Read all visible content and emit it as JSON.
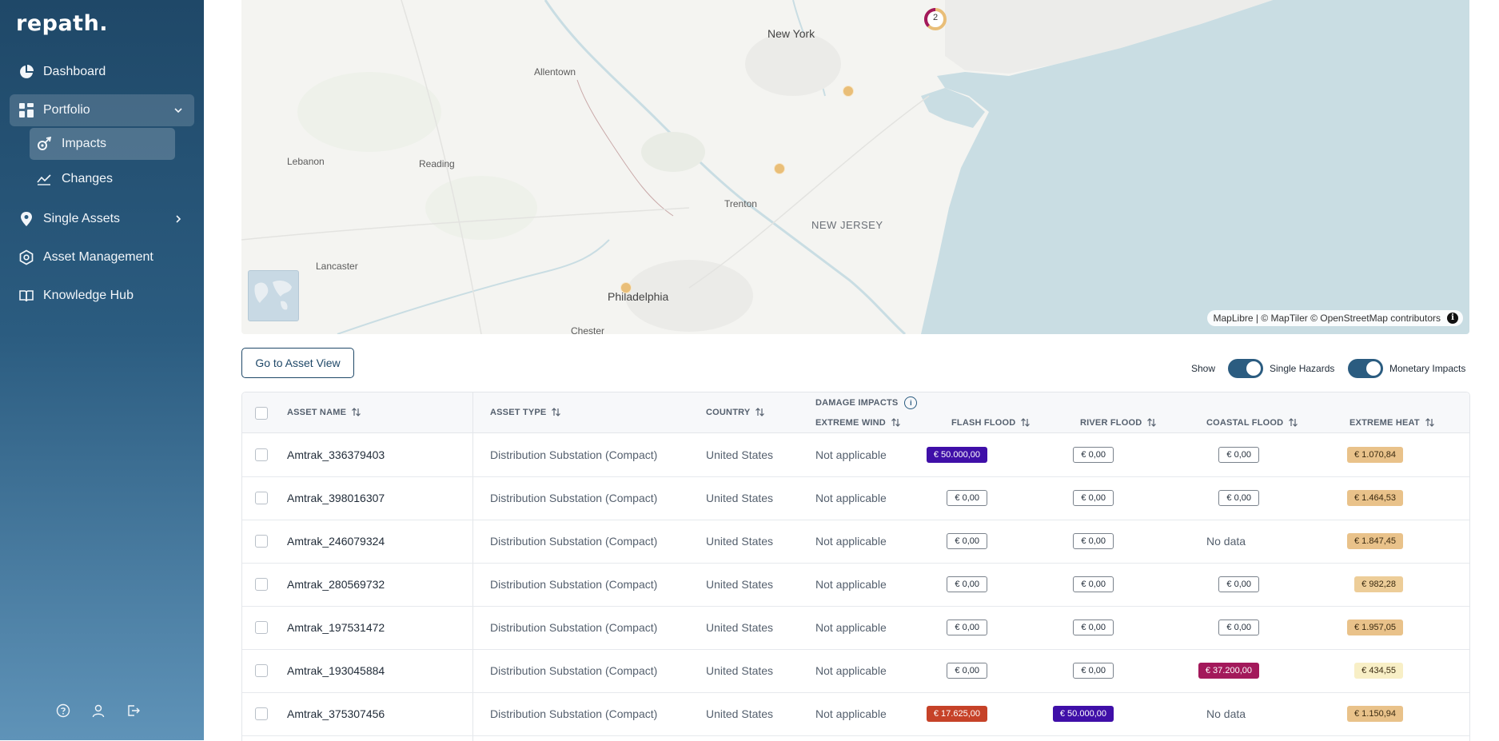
{
  "sidebar": {
    "logo": "repath.",
    "items": [
      {
        "label": "Dashboard"
      },
      {
        "label": "Portfolio"
      },
      {
        "label": "Impacts"
      },
      {
        "label": "Changes"
      },
      {
        "label": "Single Assets"
      },
      {
        "label": "Asset Management"
      },
      {
        "label": "Knowledge Hub"
      }
    ],
    "bottom_icons": [
      "help-icon",
      "user-icon",
      "logout-icon"
    ]
  },
  "map": {
    "labels": {
      "new_york": "New York",
      "allentown": "Allentown",
      "lebanon": "Lebanon",
      "reading": "Reading",
      "trenton": "Trenton",
      "new_jersey": "NEW JERSEY",
      "lancaster": "Lancaster",
      "philadelphia": "Philadelphia",
      "chester": "Chester"
    },
    "cluster_count": "2",
    "attribution": "MapLibre | © MapTiler © OpenStreetMap contributors",
    "colors": {
      "land": "#f4f4f1",
      "water": "#c9dde3",
      "marker": "#e9be78",
      "cluster": "#a3195b"
    }
  },
  "toolbar": {
    "asset_view_button": "Go to Asset View",
    "show_label": "Show",
    "toggle_single_hazards": "Single Hazards",
    "toggle_monetary_impacts": "Monetary Impacts"
  },
  "table": {
    "headers": {
      "asset_name": "ASSET NAME",
      "asset_type": "ASSET TYPE",
      "country": "COUNTRY",
      "damage_impacts": "DAMAGE IMPACTS",
      "extreme_wind": "EXTREME WIND",
      "flash_flood": "FLASH FLOOD",
      "river_flood": "RIVER FLOOD",
      "coastal_flood": "COASTAL FLOOD",
      "extreme_heat": "EXTREME HEAT"
    },
    "rows": [
      {
        "name": "Amtrak_336379403",
        "type": "Distribution Substation (Compact)",
        "country": "United States",
        "wind": "Not applicable",
        "flash": "€ 50.000,00",
        "river": "€ 0,00",
        "coastal": "€ 0,00",
        "heat": "€ 1.070,84"
      },
      {
        "name": "Amtrak_398016307",
        "type": "Distribution Substation (Compact)",
        "country": "United States",
        "wind": "Not applicable",
        "flash": "€ 0,00",
        "river": "€ 0,00",
        "coastal": "€ 0,00",
        "heat": "€ 1.464,53"
      },
      {
        "name": "Amtrak_246079324",
        "type": "Distribution Substation (Compact)",
        "country": "United States",
        "wind": "Not applicable",
        "flash": "€ 0,00",
        "river": "€ 0,00",
        "coastal": "No data",
        "heat": "€ 1.847,45"
      },
      {
        "name": "Amtrak_280569732",
        "type": "Distribution Substation (Compact)",
        "country": "United States",
        "wind": "Not applicable",
        "flash": "€ 0,00",
        "river": "€ 0,00",
        "coastal": "€ 0,00",
        "heat": "€ 982,28"
      },
      {
        "name": "Amtrak_197531472",
        "type": "Distribution Substation (Compact)",
        "country": "United States",
        "wind": "Not applicable",
        "flash": "€ 0,00",
        "river": "€ 0,00",
        "coastal": "€ 0,00",
        "heat": "€ 1.957,05"
      },
      {
        "name": "Amtrak_193045884",
        "type": "Distribution Substation (Compact)",
        "country": "United States",
        "wind": "Not applicable",
        "flash": "€ 0,00",
        "river": "€ 0,00",
        "coastal": "€ 37.200,00",
        "heat": "€ 434,55"
      },
      {
        "name": "Amtrak_375307456",
        "type": "Distribution Substation (Compact)",
        "country": "United States",
        "wind": "Not applicable",
        "flash": "€ 17.625,00",
        "river": "€ 50.000,00",
        "coastal": "No data",
        "heat": "€ 1.150,94"
      }
    ],
    "badge_colors": {
      "€ 50.000,00": {
        "bg": "#3f0fa8",
        "fg": "#ffffff"
      },
      "€ 37.200,00": {
        "bg": "#a3195b",
        "fg": "#ffffff"
      },
      "€ 17.625,00": {
        "bg": "#c64228",
        "fg": "#ffffff"
      },
      "€ 1.070,84": {
        "bg": "#e9c28a",
        "fg": "#3a2a10"
      },
      "€ 1.464,53": {
        "bg": "#e9c28a",
        "fg": "#3a2a10"
      },
      "€ 1.847,45": {
        "bg": "#e9c28a",
        "fg": "#3a2a10"
      },
      "€ 982,28": {
        "bg": "#edcd98",
        "fg": "#3a2a10"
      },
      "€ 1.957,05": {
        "bg": "#e9c28a",
        "fg": "#3a2a10"
      },
      "€ 434,55": {
        "bg": "#f8efc6",
        "fg": "#3a2a10"
      },
      "€ 1.150,94": {
        "bg": "#e9c28a",
        "fg": "#3a2a10"
      }
    }
  }
}
